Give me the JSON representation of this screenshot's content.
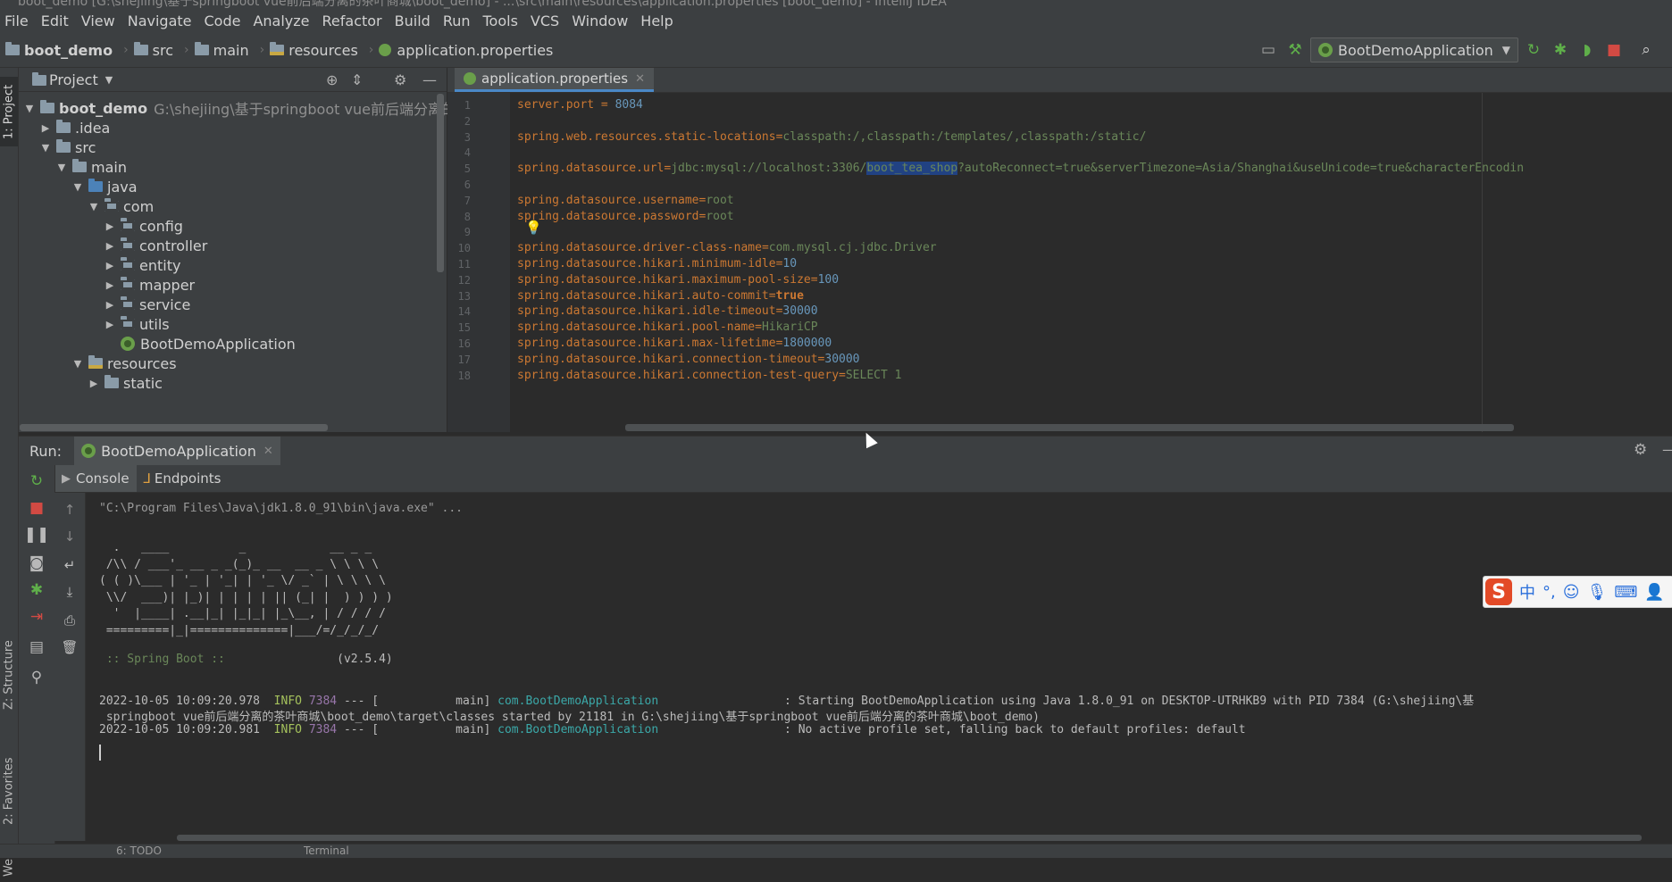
{
  "window": {
    "title": "boot_demo [G:\\shejiing\\基于springboot vue前后端分离的茶叶商城\\boot_demo] - ...\\src\\main\\resources\\application.properties [boot_demo] - IntelliJ IDEA"
  },
  "menu": [
    "File",
    "Edit",
    "View",
    "Navigate",
    "Code",
    "Analyze",
    "Refactor",
    "Build",
    "Run",
    "Tools",
    "VCS",
    "Window",
    "Help"
  ],
  "breadcrumb": [
    "boot_demo",
    "src",
    "main",
    "resources",
    "application.properties"
  ],
  "toolbar": {
    "run_config": "BootDemoApplication"
  },
  "left_strip": {
    "project": "1: Project",
    "structure": "Z: Structure",
    "favorites": "2: Favorites",
    "web": "Web"
  },
  "project_panel": {
    "title": "Project",
    "tree": [
      {
        "label": "boot_demo",
        "path": "G:\\shejiing\\基于springboot vue前后端分离的茶叶",
        "depth": 0,
        "expanded": true,
        "icon": "module"
      },
      {
        "label": ".idea",
        "depth": 1,
        "expanded": false,
        "icon": "folder"
      },
      {
        "label": "src",
        "depth": 1,
        "expanded": true,
        "icon": "folder"
      },
      {
        "label": "main",
        "depth": 2,
        "expanded": true,
        "icon": "folder"
      },
      {
        "label": "java",
        "depth": 3,
        "expanded": true,
        "icon": "folder-blue"
      },
      {
        "label": "com",
        "depth": 4,
        "expanded": true,
        "icon": "package"
      },
      {
        "label": "config",
        "depth": 5,
        "expanded": false,
        "icon": "package"
      },
      {
        "label": "controller",
        "depth": 5,
        "expanded": false,
        "icon": "package"
      },
      {
        "label": "entity",
        "depth": 5,
        "expanded": false,
        "icon": "package"
      },
      {
        "label": "mapper",
        "depth": 5,
        "expanded": false,
        "icon": "package"
      },
      {
        "label": "service",
        "depth": 5,
        "expanded": false,
        "icon": "package"
      },
      {
        "label": "utils",
        "depth": 5,
        "expanded": false,
        "icon": "package"
      },
      {
        "label": "BootDemoApplication",
        "depth": 5,
        "leaf": true,
        "icon": "spring-class"
      },
      {
        "label": "resources",
        "depth": 3,
        "expanded": true,
        "icon": "folder-res"
      },
      {
        "label": "static",
        "depth": 4,
        "expanded": false,
        "icon": "folder"
      }
    ]
  },
  "editor": {
    "tab": "application.properties",
    "lines": [
      {
        "n": "1",
        "k": "server.port",
        "sep": " = ",
        "v": "8084",
        "type": "num"
      },
      {
        "n": "2"
      },
      {
        "n": "3",
        "k": "spring.web.resources.static-locations",
        "sep": "=",
        "v": "classpath:/,classpath:/templates/,classpath:/static/"
      },
      {
        "n": "4"
      },
      {
        "n": "5",
        "k": "spring.datasource.url",
        "sep": "=",
        "v": "jdbc:mysql://localhost:3306/",
        "sel": "boot_tea_shop",
        "rest": "?autoReconnect=true&serverTimezone=Asia/Shanghai&useUnicode=true&characterEncodin"
      },
      {
        "n": "6"
      },
      {
        "n": "7",
        "k": "spring.datasource.username",
        "sep": "=",
        "v": "root"
      },
      {
        "n": "8",
        "k": "spring.datasource.password",
        "sep": "=",
        "v": "root"
      },
      {
        "n": "9"
      },
      {
        "n": "10",
        "k": "spring.datasource.driver-class-name",
        "sep": "=",
        "v": "com.mysql.cj.jdbc.Driver"
      },
      {
        "n": "11",
        "k": "spring.datasource.hikari.minimum-idle",
        "sep": "=",
        "v": "10",
        "type": "num"
      },
      {
        "n": "12",
        "k": "spring.datasource.hikari.maximum-pool-size",
        "sep": "=",
        "v": "100",
        "type": "num"
      },
      {
        "n": "13",
        "k": "spring.datasource.hikari.auto-commit",
        "sep": "=",
        "v": "true",
        "type": "bool"
      },
      {
        "n": "14",
        "k": "spring.datasource.hikari.idle-timeout",
        "sep": "=",
        "v": "30000",
        "type": "num"
      },
      {
        "n": "15",
        "k": "spring.datasource.hikari.pool-name",
        "sep": "=",
        "v": "HikariCP"
      },
      {
        "n": "16",
        "k": "spring.datasource.hikari.max-lifetime",
        "sep": "=",
        "v": "1800000",
        "type": "num"
      },
      {
        "n": "17",
        "k": "spring.datasource.hikari.connection-timeout",
        "sep": "=",
        "v": "30000",
        "type": "num"
      },
      {
        "n": "18",
        "k": "spring.datasource.hikari.connection-test-query",
        "sep": "=",
        "v": "SELECT 1"
      }
    ]
  },
  "run_panel": {
    "label": "Run:",
    "tab": "BootDemoApplication",
    "subtabs": [
      "Console",
      "Endpoints"
    ],
    "console": {
      "cmd": "\"C:\\Program Files\\Java\\jdk1.8.0_91\\bin\\java.exe\" ...",
      "banner": [
        "  .   ____          _            __ _ _",
        " /\\\\ / ___'_ __ _ _(_)_ __  __ _ \\ \\ \\ \\",
        "( ( )\\___ | '_ | '_| | '_ \\/ _` | \\ \\ \\ \\",
        " \\\\/  ___)| |_)| | | | | || (_| |  ) ) ) )",
        "  '  |____| .__|_| |_|_| |_\\__, | / / / /",
        " =========|_|==============|___/=/_/_/_/"
      ],
      "spring_label": " :: Spring Boot :: ",
      "spring_version": "               (v2.5.4)",
      "logs": [
        {
          "ts": "2022-10-05 10:09:20.978",
          "level": "INFO",
          "pid": "7384",
          "thread": " --- [           main] ",
          "cls": "com.BootDemoApplication",
          "msg": "                  : Starting BootDemoApplication using Java 1.8.0_91 on DESKTOP-UTRHKB9 with PID 7384 (G:\\shejiing\\基"
        },
        {
          "cont": " springboot vue前后端分离的茶叶商城\\boot_demo\\target\\classes started by 21181 in G:\\shejiing\\基于springboot vue前后端分离的茶叶商城\\boot_demo)"
        },
        {
          "ts": "2022-10-05 10:09:20.981",
          "level": "INFO",
          "pid": "7384",
          "thread": " --- [           main] ",
          "cls": "com.BootDemoApplication",
          "msg": "                  : No active profile set, falling back to default profiles: default"
        }
      ]
    }
  },
  "ime": {
    "logo": "S",
    "lang": "中"
  },
  "statusbar": {
    "todo": "6: TODO",
    "terminal": "Terminal"
  },
  "colors": {
    "bg": "#2b2b2b",
    "panel": "#3c3f41",
    "key": "#cc7832",
    "value": "#6a8759",
    "number": "#6897bb",
    "selection": "#214283"
  }
}
